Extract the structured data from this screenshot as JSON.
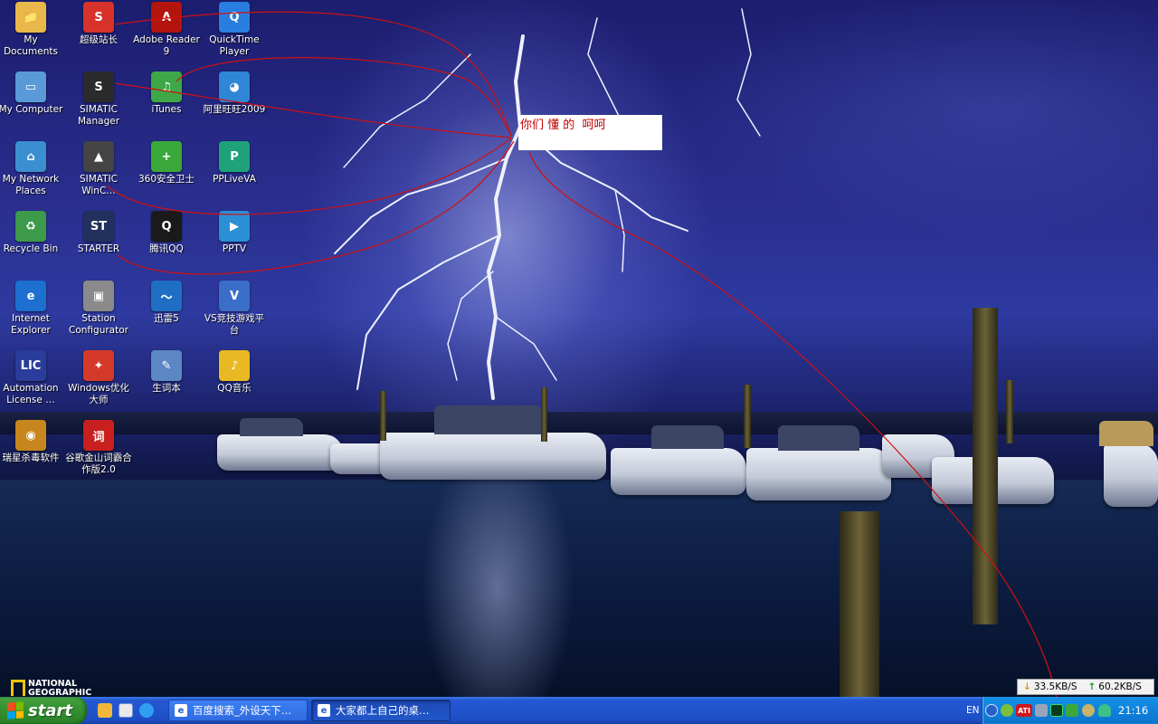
{
  "desktop": {
    "icons": [
      {
        "label": "My Documents",
        "color": "#e8b84a",
        "glyph": "📁"
      },
      {
        "label": "超级站长",
        "color": "#d8332a",
        "glyph": "S"
      },
      {
        "label": "Adobe Reader 9",
        "color": "#b4140e",
        "glyph": "A"
      },
      {
        "label": "QuickTime Player",
        "color": "#2a7de0",
        "glyph": "Q"
      },
      {
        "label": "My Computer",
        "color": "#5a9ad8",
        "glyph": "▭"
      },
      {
        "label": "SIMATIC Manager",
        "color": "#2b2b2b",
        "glyph": "S"
      },
      {
        "label": "iTunes",
        "color": "#3ea848",
        "glyph": "♫"
      },
      {
        "label": "阿里旺旺2009",
        "color": "#2f86d6",
        "glyph": "◕"
      },
      {
        "label": "My Network Places",
        "color": "#3b8fd0",
        "glyph": "⌂"
      },
      {
        "label": "SIMATIC WinC…",
        "color": "#444444",
        "glyph": "▲"
      },
      {
        "label": "360安全卫士",
        "color": "#3aa83a",
        "glyph": "+"
      },
      {
        "label": "PPLiveVA",
        "color": "#1fa27a",
        "glyph": "P"
      },
      {
        "label": "Recycle Bin",
        "color": "#3c9a4a",
        "glyph": "♻"
      },
      {
        "label": "STARTER",
        "color": "#22305e",
        "glyph": "ST"
      },
      {
        "label": "腾讯QQ",
        "color": "#1a1a1a",
        "glyph": "Q"
      },
      {
        "label": "PPTV",
        "color": "#2b8fd6",
        "glyph": "▶"
      },
      {
        "label": "Internet Explorer",
        "color": "#1d6fd0",
        "glyph": "e"
      },
      {
        "label": "Station Configurator",
        "color": "#8a8a8a",
        "glyph": "▣"
      },
      {
        "label": "迅雷5",
        "color": "#1e6fc4",
        "glyph": "〜"
      },
      {
        "label": "VS竞技游戏平台",
        "color": "#3b6ec8",
        "glyph": "V"
      },
      {
        "label": "Automation License …",
        "color": "#2a3d9a",
        "glyph": "LIC"
      },
      {
        "label": "Windows优化大师",
        "color": "#d43a2a",
        "glyph": "✦"
      },
      {
        "label": "生词本",
        "color": "#5b87c4",
        "glyph": "✎"
      },
      {
        "label": "QQ音乐",
        "color": "#e9b923",
        "glyph": "♪"
      },
      {
        "label": "瑞星杀毒软件",
        "color": "#c8861e",
        "glyph": "◉"
      },
      {
        "label": "谷歌金山词霸合作版2.0",
        "color": "#c8201e",
        "glyph": "词"
      }
    ]
  },
  "annotation": {
    "text": "你们 懂 的  呵呵",
    "color": "#c00000"
  },
  "wallpaper": {
    "brand": "NATIONAL GEOGRAPHIC",
    "brand_line1": "NATIONAL",
    "brand_line2": "GEOGRAPHIC"
  },
  "netspeed": {
    "down": "33.5KB/S",
    "up": "60.2KB/S"
  },
  "taskbar": {
    "start_label": "start",
    "tasks": [
      {
        "label": "百度搜索_外设天下…",
        "active": false
      },
      {
        "label": "大家都上自己的桌…",
        "active": true
      }
    ],
    "tray": {
      "language": "EN",
      "ati_label": "ATI",
      "clock": "21:16"
    }
  }
}
